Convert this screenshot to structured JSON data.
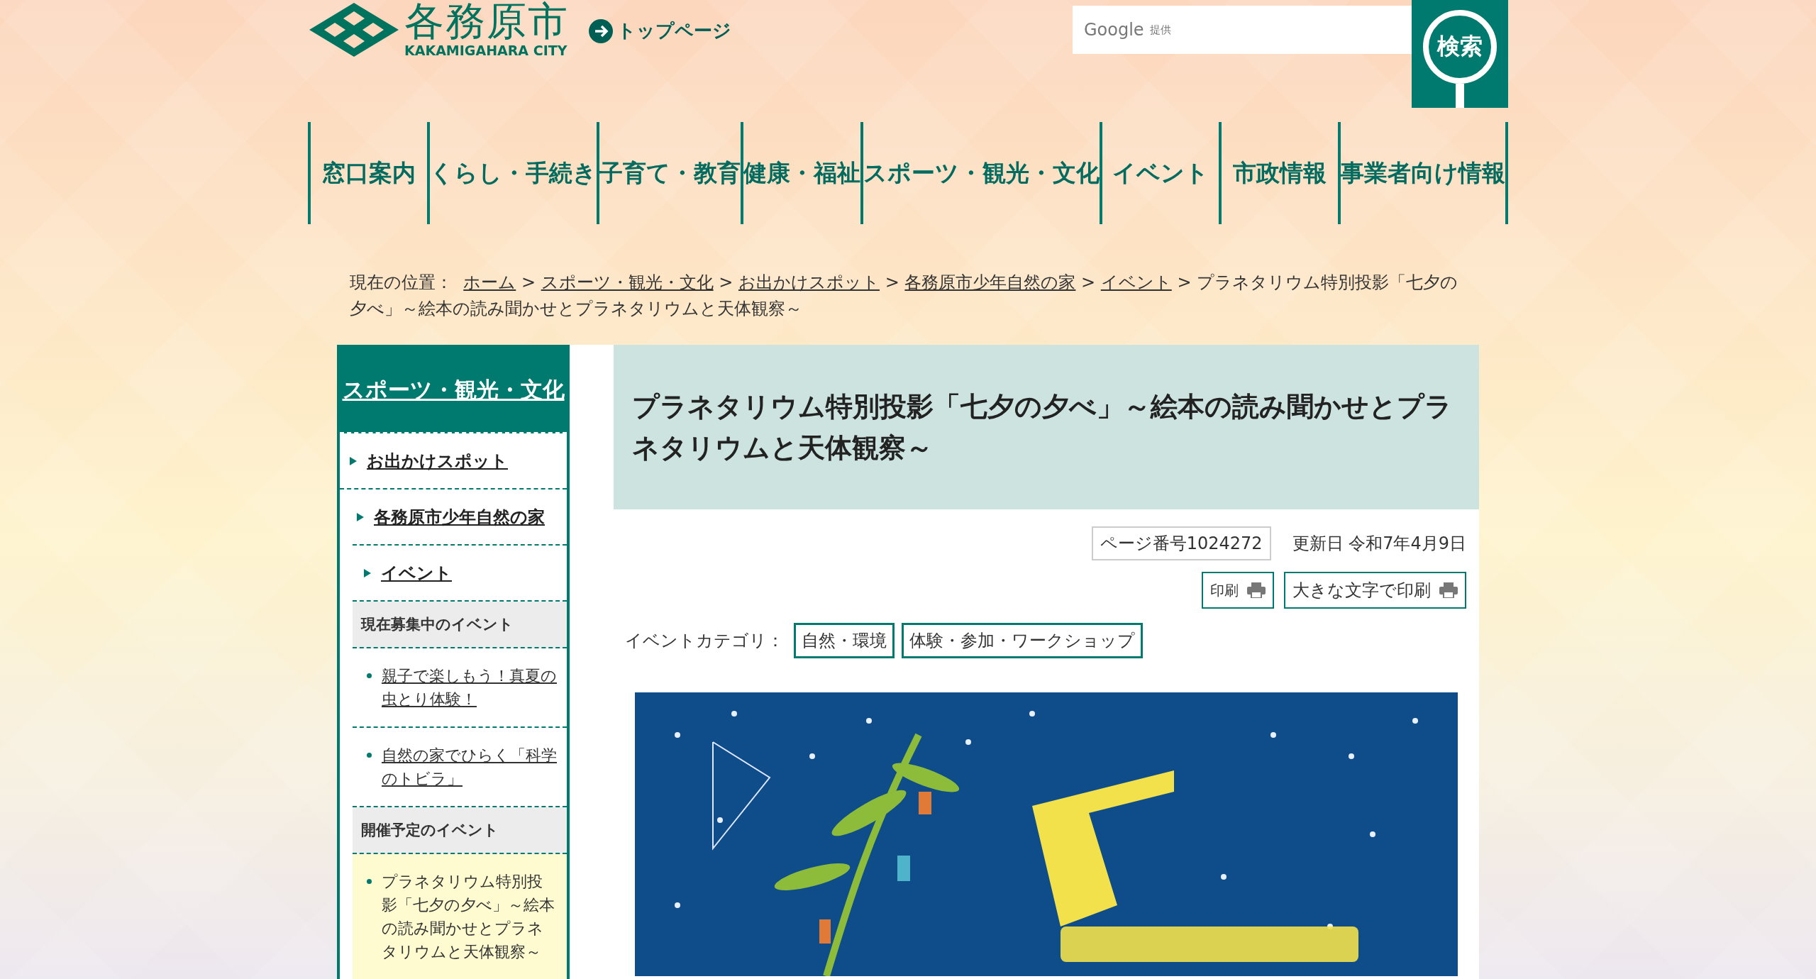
{
  "header": {
    "logo": {
      "name": "各務原市",
      "name_en": "KAKAMIGAHARA CITY"
    },
    "top_link": "トップページ",
    "search": {
      "provider": "Google",
      "provider_note": "提供",
      "button": "検索"
    }
  },
  "nav": [
    {
      "lines": [
        "窓口案内"
      ]
    },
    {
      "lines": [
        "くらし・",
        "手続き"
      ]
    },
    {
      "lines": [
        "子育て・",
        "教育"
      ]
    },
    {
      "lines": [
        "健康・",
        "福祉"
      ]
    },
    {
      "lines": [
        "スポーツ・",
        "観光・文化"
      ]
    },
    {
      "lines": [
        "イベント"
      ]
    },
    {
      "lines": [
        "市政情報"
      ]
    },
    {
      "lines": [
        "事業者向け",
        "情報"
      ]
    }
  ],
  "breadcrumb": {
    "label": "現在の位置：",
    "links": [
      "ホーム",
      "スポーツ・観光・文化",
      "お出かけスポット",
      "各務原市少年自然の家",
      "イベント"
    ],
    "separator": ">",
    "current": "プラネタリウム特別投影「七夕の夕べ」～絵本の読み聞かせとプラネタリウムと天体観察～"
  },
  "sidebar": {
    "title": "スポーツ・観光・文化",
    "tree": [
      {
        "label": "お出かけスポット",
        "children": [
          {
            "label": "各務原市少年自然の家",
            "children": [
              {
                "label": "イベント"
              }
            ]
          }
        ]
      }
    ],
    "sections": [
      {
        "heading": "現在募集中のイベント",
        "items": [
          {
            "label": "親子で楽しもう！真夏の虫とり体験！",
            "selected": false
          },
          {
            "label": "自然の家でひらく「科学のトビラ」",
            "selected": false
          }
        ]
      },
      {
        "heading": "開催予定のイベント",
        "items": [
          {
            "label": "プラネタリウム特別投影「七夕の夕べ」～絵本の読み聞かせとプラネタリウムと天体観察～",
            "selected": true
          }
        ]
      }
    ]
  },
  "main": {
    "title": "プラネタリウム特別投影「七夕の夕べ」～絵本の読み聞かせとプラネタリウムと天体観察～",
    "page_number": "ページ番号1024272",
    "updated": "更新日 令和7年4月9日",
    "print_buttons": [
      "印刷",
      "大きな文字で印刷"
    ],
    "category_label": "イベントカテゴリ：",
    "categories": [
      "自然・環境",
      "体験・参加・ワークショップ"
    ]
  }
}
